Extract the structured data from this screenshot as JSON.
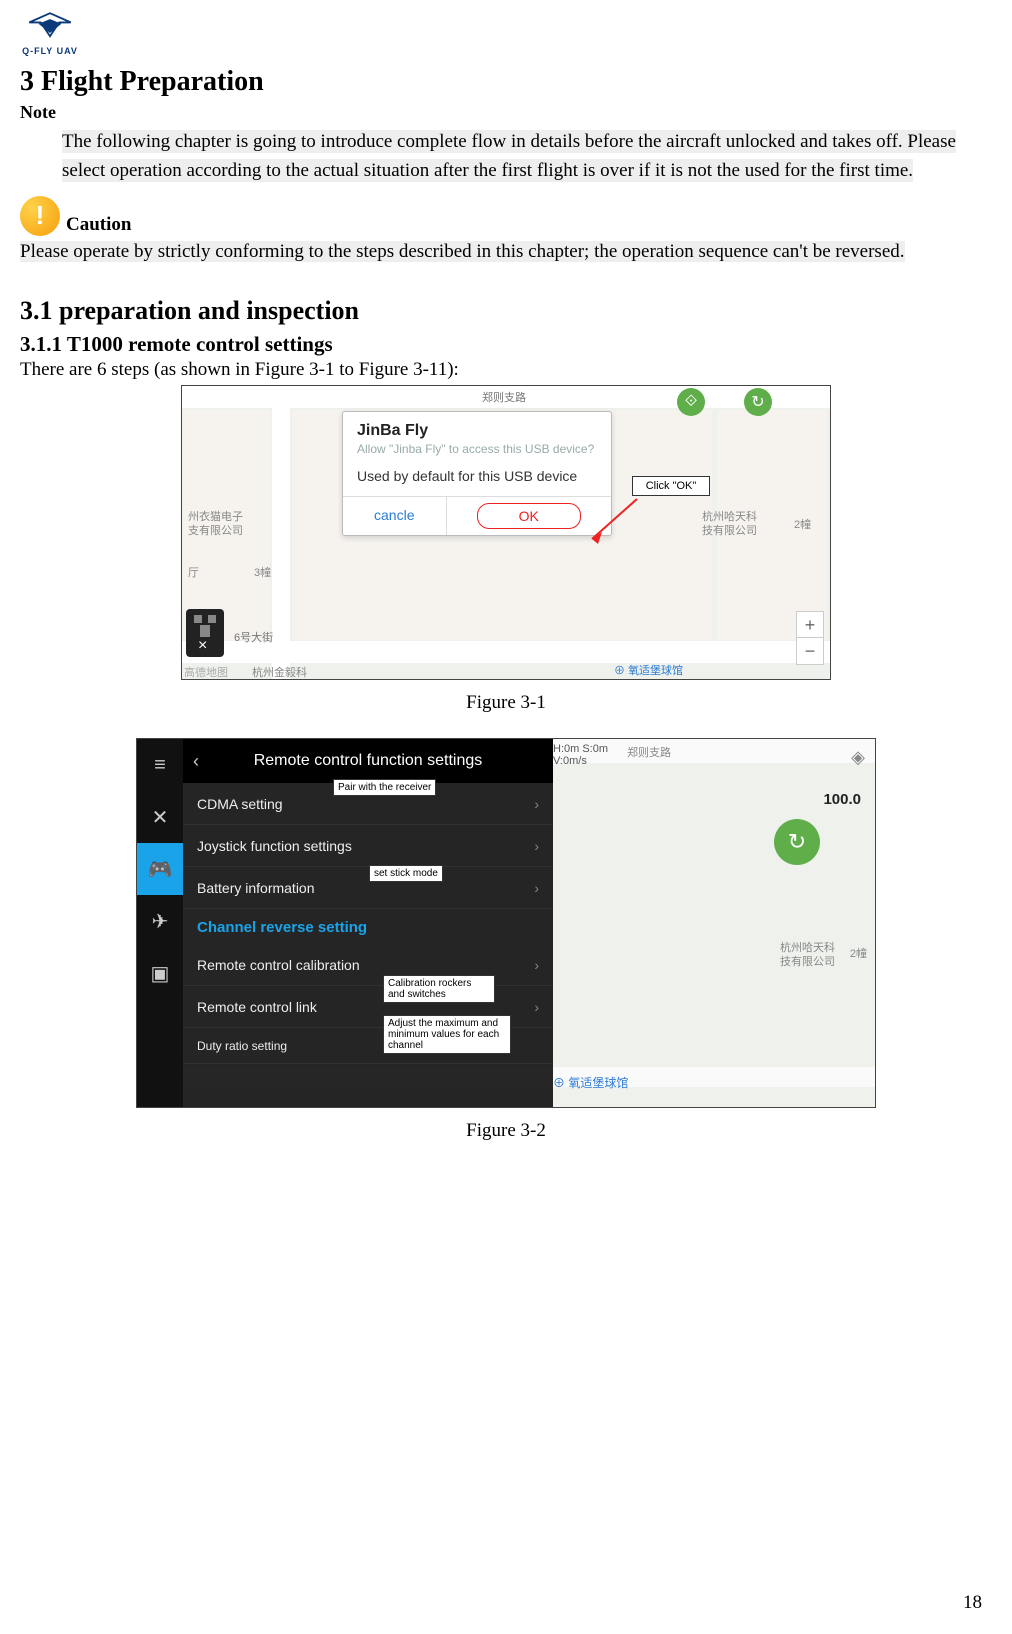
{
  "logo": {
    "brand": "Q-FLY UAV"
  },
  "section": {
    "number": "3",
    "title": "3   Flight Preparation",
    "note_label": "Note",
    "note_body": "The following chapter is going to introduce complete flow in details before the aircraft unlocked and takes off. Please select operation according to the actual situation after the first flight is over if it is not the used for the first time.",
    "caution_label": "Caution",
    "caution_body": "Please operate by strictly conforming to the steps described in this chapter; the operation sequence can't be reversed."
  },
  "sub31": {
    "title": "3.1 preparation and inspection",
    "sub_title": "3.1.1    T1000 remote control settings",
    "intro": "There are 6 steps (as shown in Figure 3-1 to Figure 3-11):",
    "fig1_caption": "Figure 3-1",
    "fig2_caption": "Figure 3-2"
  },
  "fig1": {
    "modal_title": "JinBa Fly",
    "modal_sub": "Allow \"Jinba Fly\" to access this USB device?",
    "modal_msg": "Used by default for this USB device",
    "cancel": "cancle",
    "ok": "OK",
    "callout": "Click \"OK\"",
    "map_road_top": "郑则支路",
    "map_road_left": "6号大街",
    "map_poi_1": "州衣猫电子",
    "map_poi_1b": "支有限公司",
    "map_poi_2": "厅",
    "map_poi_3": "3幢",
    "map_poi_4": "杭州哈天科",
    "map_poi_4b": "技有限公司",
    "map_poi_5": "2幢",
    "map_poi_bl": "杭州金毅科",
    "map_poi_br": "氧适堡球馆",
    "map_watermark": "高德地图"
  },
  "fig2": {
    "header": "Remote control function settings",
    "items": [
      "CDMA setting",
      "Joystick function settings",
      "Battery information"
    ],
    "highlight": "Channel reverse setting",
    "items2": [
      "Remote control calibration",
      "Remote control link",
      "Duty ratio setting"
    ],
    "tag_pair": "Pair with the receiver",
    "tag_stick": "set stick mode",
    "tag_cal": "Calibration rockers and switches",
    "tag_adj": "Adjust the maximum and minimum values for each channel",
    "stat_h": "H:0m   S:0m",
    "stat_v": "V:0m/s",
    "pct": "100.0",
    "map_cn_1": "郑则支路",
    "map_cn_2": "杭州哈天科",
    "map_cn_2b": "技有限公司",
    "map_cn_3": "2幢",
    "map_cn_4": "氧适堡球馆"
  },
  "page_number": "18"
}
